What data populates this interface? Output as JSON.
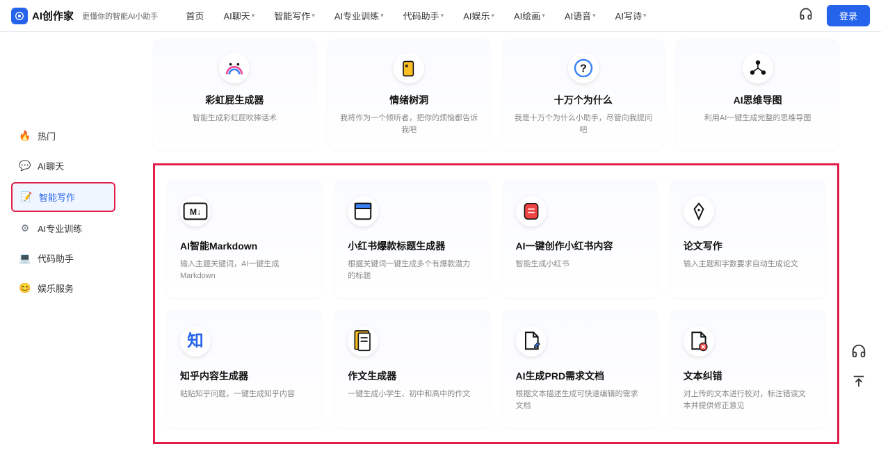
{
  "header": {
    "logo_text": "AI创作家",
    "tagline": "更懂你的智能AI小助手",
    "nav": [
      "首页",
      "AI聊天",
      "智能写作",
      "AI专业训练",
      "代码助手",
      "AI娱乐",
      "AI绘画",
      "AI语音",
      "AI写诗"
    ],
    "nav_has_dropdown": [
      false,
      true,
      true,
      true,
      true,
      true,
      true,
      true,
      true
    ],
    "login": "登录"
  },
  "sidebar": {
    "items": [
      {
        "label": "热门",
        "icon": "🔥"
      },
      {
        "label": "AI聊天",
        "icon": "💬"
      },
      {
        "label": "智能写作",
        "icon": "📝"
      },
      {
        "label": "AI专业训练",
        "icon": "⚙"
      },
      {
        "label": "代码助手",
        "icon": "💻"
      },
      {
        "label": "娱乐服务",
        "icon": "😊"
      }
    ],
    "active_index": 2
  },
  "row1": [
    {
      "title": "彩虹屁生成器",
      "desc": "智能生成彩虹屁吹捧话术"
    },
    {
      "title": "情绪树洞",
      "desc": "我将作为一个倾听者，把你的烦恼都告诉我吧"
    },
    {
      "title": "十万个为什么",
      "desc": "我是十万个为什么小助手，尽管向我提问吧"
    },
    {
      "title": "AI思维导图",
      "desc": "利用AI一键生成完整的思维导图"
    }
  ],
  "row2": [
    {
      "title": "AI智能Markdown",
      "desc": "输入主题关键词，AI一键生成Markdown"
    },
    {
      "title": "小红书爆款标题生成器",
      "desc": "根据关键词一键生成多个有爆款潜力的标题"
    },
    {
      "title": "AI一键创作小红书内容",
      "desc": "智能生成小红书"
    },
    {
      "title": "论文写作",
      "desc": "输入主题和字数要求自动生成论文"
    }
  ],
  "row3": [
    {
      "title": "知乎内容生成器",
      "desc": "粘贴知乎问题，一键生成知乎内容"
    },
    {
      "title": "作文生成器",
      "desc": "一键生成小学生、初中和高中的作文"
    },
    {
      "title": "AI生成PRD需求文档",
      "desc": "根据文本描述生成可快速编辑的需求文档"
    },
    {
      "title": "文本纠错",
      "desc": "对上传的文本进行校对，标注错误文本并提供修正意见"
    }
  ]
}
